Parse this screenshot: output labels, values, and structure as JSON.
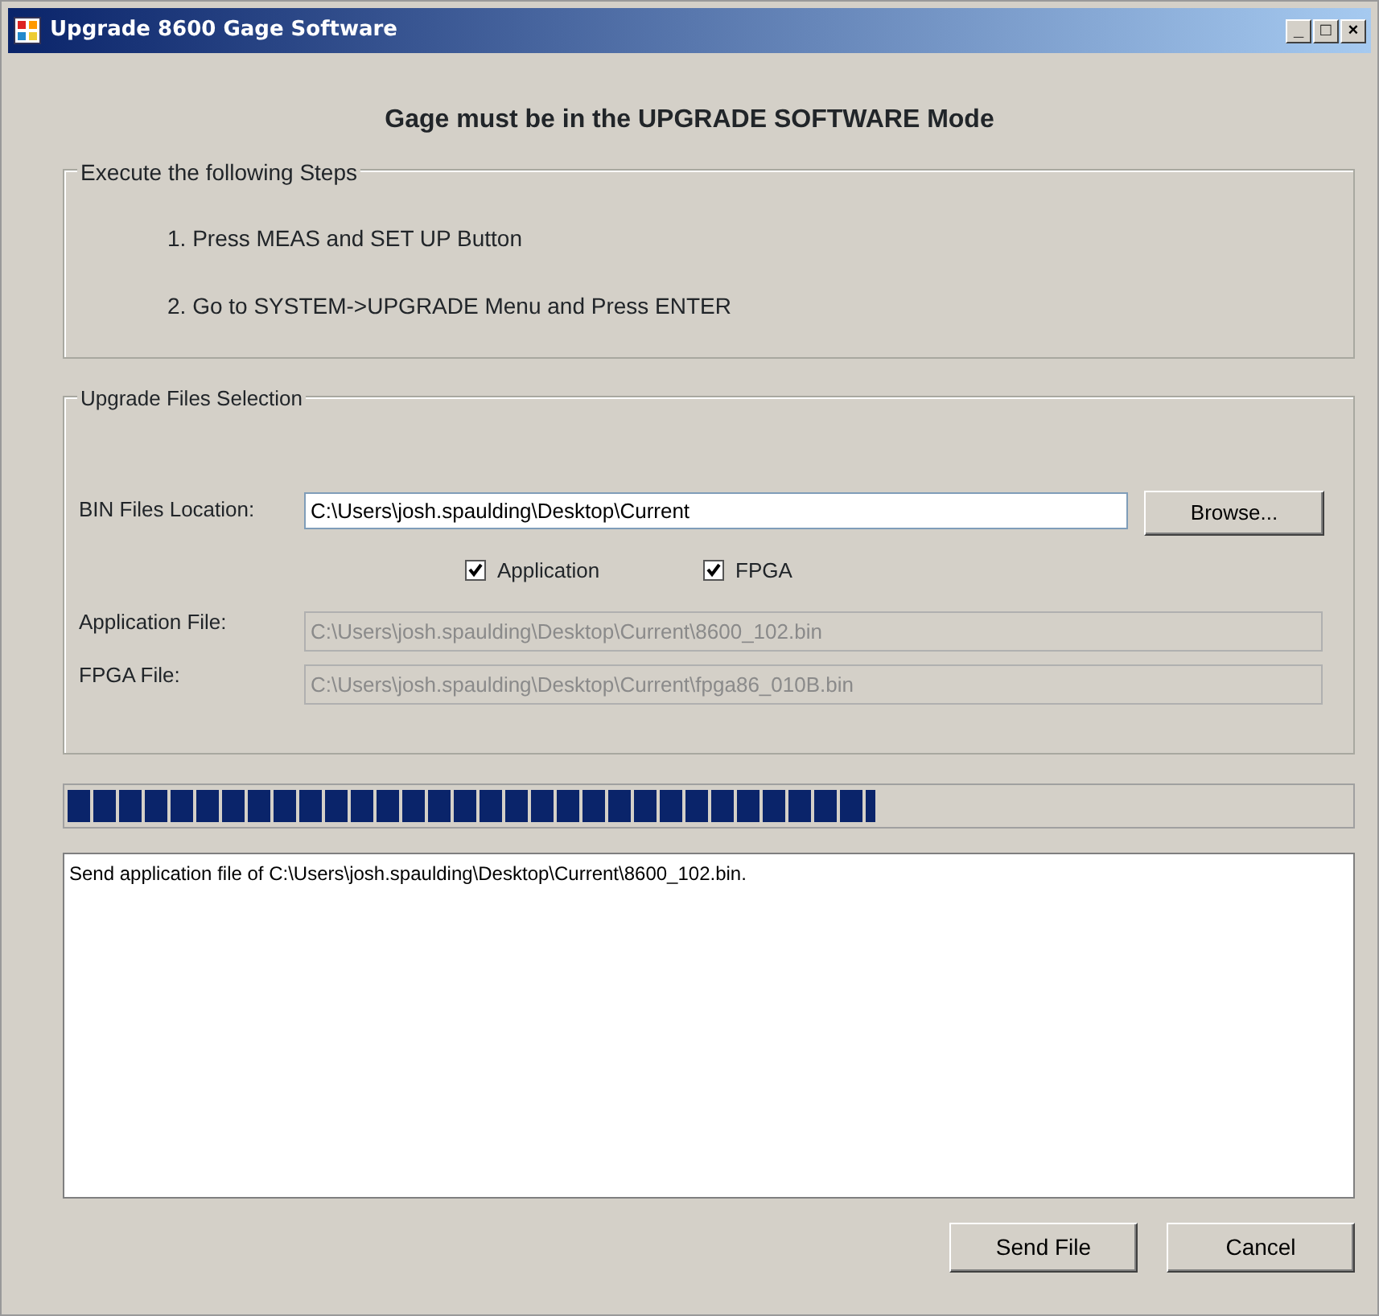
{
  "window": {
    "title": "Upgrade 8600 Gage Software",
    "controls": [
      "_",
      "□",
      "×"
    ]
  },
  "heading": "Gage must be in the UPGRADE SOFTWARE Mode",
  "steps_group": {
    "title": "Execute the following Steps",
    "steps": [
      "1.  Press MEAS and SET UP Button",
      "2.  Go to SYSTEM->UPGRADE Menu and Press ENTER"
    ]
  },
  "files_group": {
    "title": "Upgrade Files Selection",
    "bin_location": {
      "label": "BIN Files Location:",
      "value": "C:\\Users\\josh.spaulding\\Desktop\\Current"
    },
    "browse_button": "Browse...",
    "checkboxes": [
      {
        "label": "Application",
        "checked": true
      },
      {
        "label": "FPGA",
        "checked": true
      }
    ],
    "files": [
      {
        "label": "Application File:",
        "value": "C:\\Users\\josh.spaulding\\Desktop\\Current\\8600_102.bin",
        "disabled": true
      },
      {
        "label": "FPGA File:",
        "value": "C:\\Users\\josh.spaulding\\Desktop\\Current\\fpga86_010B.bin",
        "disabled": true
      }
    ]
  },
  "progress": {
    "level": 0.63
  },
  "log": "Send application file of C:\\Users\\josh.spaulding\\Desktop\\Current\\8600_102.bin.",
  "buttons": [
    "Send File",
    "Cancel"
  ]
}
